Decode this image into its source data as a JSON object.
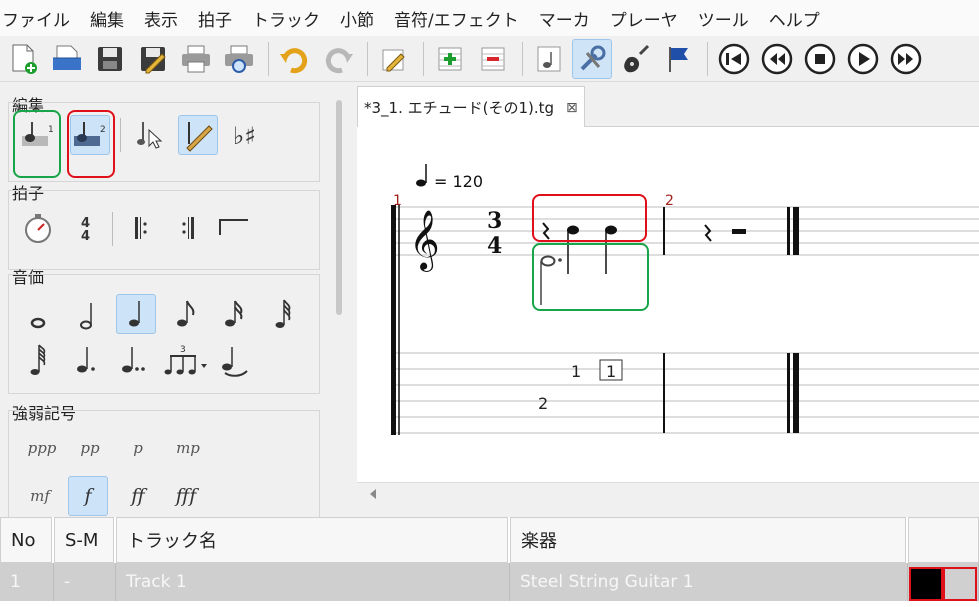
{
  "menu": [
    "ファイル",
    "編集",
    "表示",
    "拍子",
    "トラック",
    "小節",
    "音符/エフェクト",
    "マーカ",
    "プレーヤ",
    "ツール",
    "ヘルプ"
  ],
  "toolbar_icons": [
    "new-file-icon",
    "open-file-icon",
    "save-icon",
    "save-as-icon",
    "print-icon",
    "print-preview-icon",
    "undo-icon",
    "redo-icon",
    "edit-mode-icon",
    "add-measure-icon",
    "remove-measure-icon",
    "note-mode-icon",
    "tools-icon",
    "guitar-icon",
    "marker-flag-icon",
    "first-icon",
    "rewind-icon",
    "stop-icon",
    "play-icon",
    "fast-forward-icon"
  ],
  "panel": {
    "edit_title": "編集",
    "time_title": "拍子",
    "duration_title": "音価",
    "dynamics_title": "強弱記号",
    "dynamics": [
      "ppp",
      "pp",
      "p",
      "mp",
      "mf",
      "f",
      "ff",
      "fff"
    ],
    "time_sig": {
      "top": "4",
      "bottom": "4"
    },
    "tuplet": "3"
  },
  "tab": {
    "label": "*3_1. エチュード(その1).tg",
    "close": "⊠"
  },
  "score": {
    "tempo": "= 120",
    "time_signature": {
      "top": "3",
      "bottom": "4"
    },
    "measure_numbers": [
      "1",
      "2"
    ],
    "tab_numbers": {
      "upper_note": "1",
      "upper_boxed": "1",
      "lower_note": "2"
    }
  },
  "tracks": {
    "headers": [
      "No",
      "S-M",
      "トラック名",
      "楽器"
    ],
    "rows": [
      {
        "no": "1",
        "sm": "-",
        "name": "Track 1",
        "instrument": "Steel String Guitar 1"
      }
    ]
  },
  "colors": {
    "highlight_red": "#e0101a",
    "highlight_green": "#18a54a",
    "selected": "#cde3f7",
    "measure_number": "#a0201a"
  }
}
